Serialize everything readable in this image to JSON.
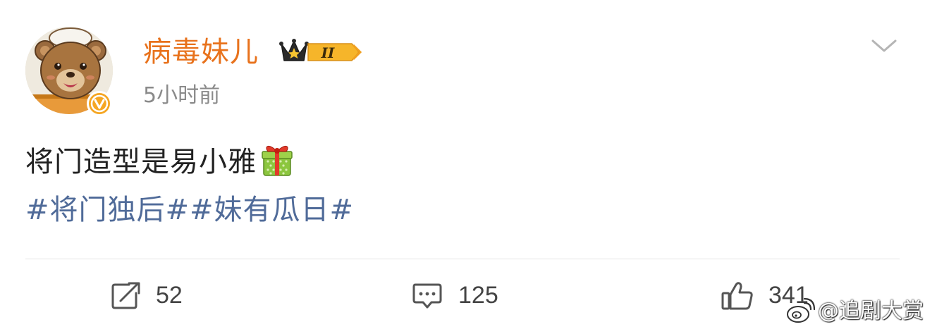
{
  "post": {
    "author": {
      "name": "病毒妹儿",
      "avatar_icon": "bear-avatar",
      "verified_icon": "verified-v-badge",
      "level_badge": {
        "icon": "crown-icon",
        "label": "II"
      }
    },
    "timestamp": "5小时前",
    "text": "将门造型是易小雅",
    "emoji_icon": "gift-icon",
    "hashtags": [
      "#将门独后#",
      "#妹有瓜日#"
    ],
    "menu_icon": "chevron-down-icon"
  },
  "actions": {
    "share": {
      "icon": "share-icon",
      "count": "52"
    },
    "comment": {
      "icon": "comment-icon",
      "count": "125"
    },
    "like": {
      "icon": "thumbs-up-icon",
      "count": "341"
    }
  },
  "watermark": {
    "text": "@追剧大赏",
    "icon": "weibo-icon"
  },
  "colors": {
    "username": "#e8721c",
    "hashtag": "#506b99",
    "text": "#222222",
    "meta": "#8a8a8a",
    "verified": "#f5a623"
  }
}
